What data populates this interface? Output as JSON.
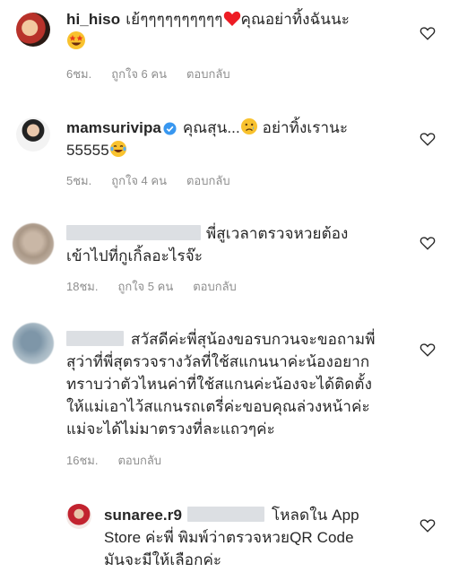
{
  "comments": [
    {
      "username": "hi_hiso",
      "text_a": "เย้ๆๆๆๆๆๆๆๆๆๆ",
      "text_b": "คุณอย่าทิ้งฉันนะ",
      "time": "6ชม.",
      "likes": "ถูกใจ 6 คน",
      "reply": "ตอบกลับ",
      "icons": [
        "red-heart-emoji",
        "star-struck-emoji"
      ]
    },
    {
      "username": "mamsurivipa",
      "text_a": "คุณสุน...",
      "text_b": "อย่าทิ้งเรานะ",
      "text_c": "55555",
      "time": "5ชม.",
      "likes": "ถูกใจ 4 คน",
      "reply": "ตอบกลับ",
      "icons": [
        "verified-badge-icon",
        "sad-face-emoji",
        "laughing-tears-emoji"
      ]
    },
    {
      "text_a": "พี่สูเวลาตรวจหวยต้อง",
      "text_b": "เข้าไปที่กูเกิ้ลอะไรจ๊ะ",
      "time": "18ชม.",
      "likes": "ถูกใจ 5 คน",
      "reply": "ตอบกลับ"
    },
    {
      "line1": "สวัสดีค่ะพี่สุน้องขอรบกวนจะขอถามพี่",
      "line2": "สุว่าที่พี่สุตรวจรางวัลที่ใช้สแกนนาค่ะน้องอยาก",
      "line3": "ทราบว่าตัวไหนค่าที่ใช้สแกนค่ะน้องจะได้ติดตั้ง",
      "line4": "ให้แม่เอาไว้สแกนรถเตรี่ค่ะขอบคุณล่วงหน้าค่ะ",
      "line5": "แม่จะได้ไม่มาตรวงที่ละแถวๆค่ะ",
      "time": "16ชม.",
      "reply": "ตอบกลับ"
    },
    {
      "username": "sunaree.r9",
      "line1": "โหลดใน App",
      "line2": "Store ค่ะพี่ พิมพ์ว่าตรวจหวยQR Code",
      "line3": "มันจะมีให้เลือกค่ะ"
    }
  ],
  "colors": {
    "text": "#262626",
    "meta": "#8e8e8e",
    "verified": "#3897f0",
    "heart_emoji": "#ed1c24",
    "redaction": "#dcdfe3"
  }
}
